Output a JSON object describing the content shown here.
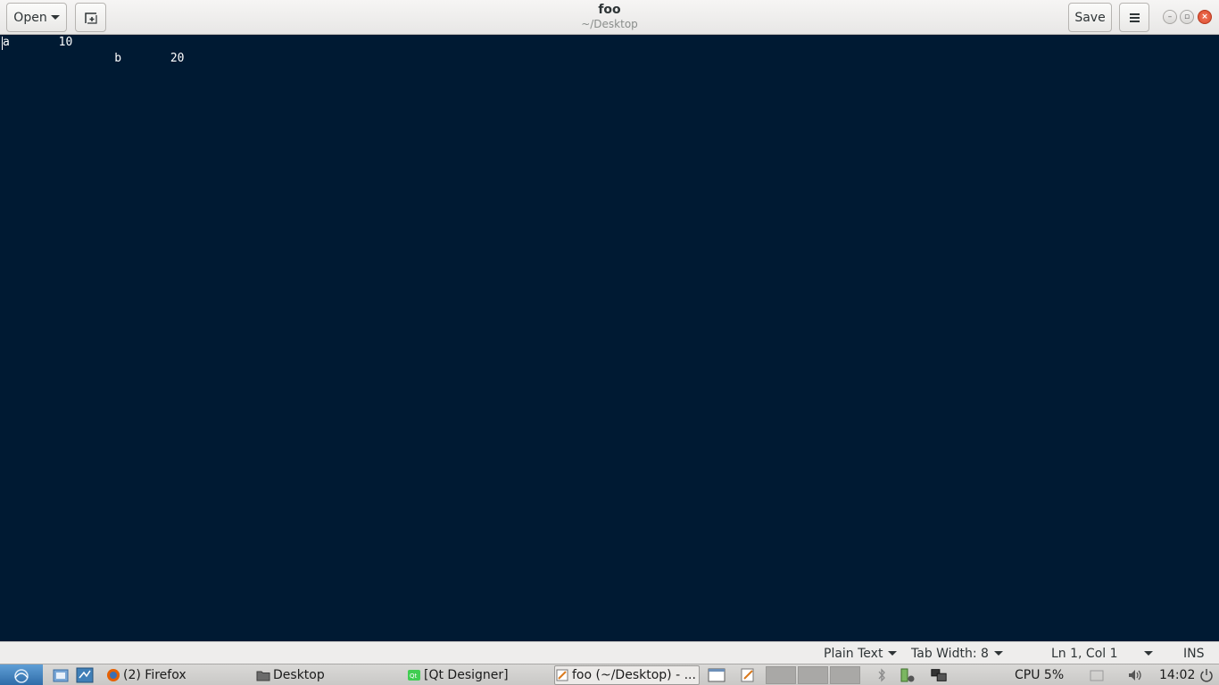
{
  "headerbar": {
    "open_label": "Open",
    "save_label": "Save",
    "title": "foo",
    "subtitle": "~/Desktop"
  },
  "editor": {
    "line1": "a       10",
    "line2": "                b       20"
  },
  "statusbar": {
    "language": "Plain Text",
    "tab_width": "Tab Width: 8",
    "position": "Ln 1, Col 1",
    "mode": "INS"
  },
  "taskbar": {
    "tasks": [
      {
        "label": "(2) Firefox"
      },
      {
        "label": "Desktop"
      },
      {
        "label": "[Qt Designer]"
      },
      {
        "label": "foo (~/Desktop) - ..."
      }
    ],
    "cpu": "CPU 5%",
    "clock": "14:02"
  },
  "colors": {
    "editor_bg": "#001a33",
    "editor_fg": "#ffffff"
  }
}
